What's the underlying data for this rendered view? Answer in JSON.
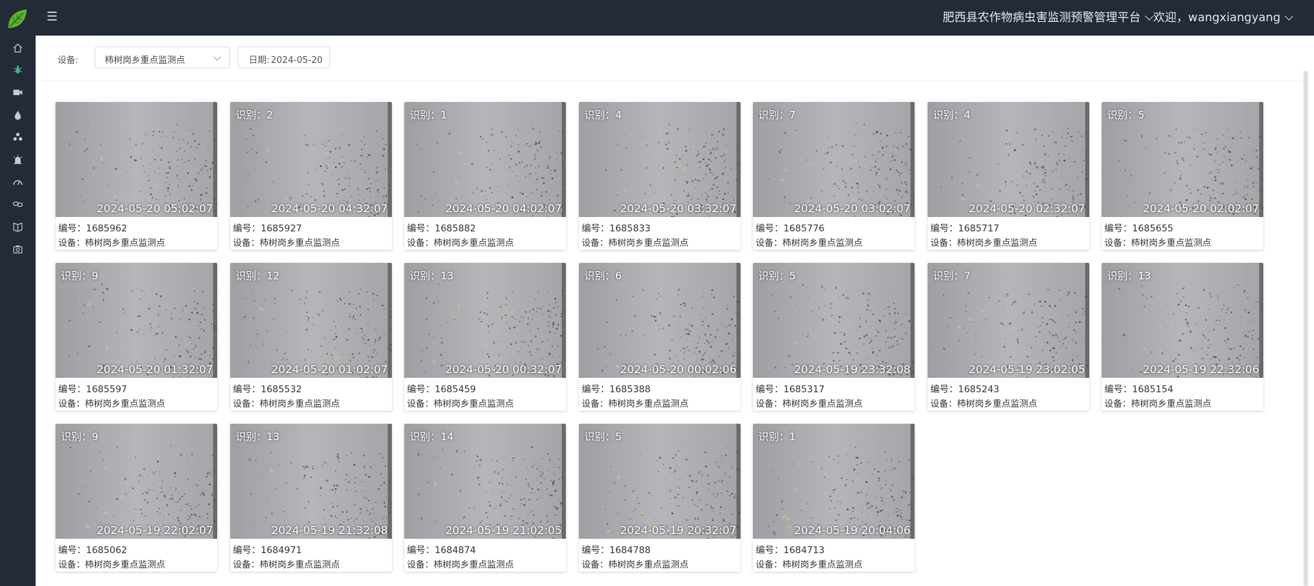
{
  "header": {
    "platform_title": "肥西县农作物病虫害监测预警管理平台",
    "welcome_text": "欢迎，wangxiangyang",
    "brand_color": "#232a38",
    "logo_color": "#5cb531"
  },
  "sidebar": {
    "items": [
      {
        "icon": "home-icon",
        "active": false
      },
      {
        "icon": "bug-icon",
        "active": true
      },
      {
        "icon": "video-camera-icon",
        "active": false
      },
      {
        "icon": "water-drop-icon",
        "active": false
      },
      {
        "icon": "molecule-icon",
        "active": false
      },
      {
        "icon": "alarm-lamp-icon",
        "active": false
      },
      {
        "icon": "gauge-icon",
        "active": false
      },
      {
        "icon": "link-icon",
        "active": false
      },
      {
        "icon": "book-icon",
        "active": false
      },
      {
        "icon": "camera-icon",
        "active": false
      }
    ],
    "active_color": "#3dbb7a"
  },
  "filters": {
    "device_label": "设备:",
    "device_value": "柿树岗乡重点监测点",
    "date_label": "日期:",
    "date_value": "2024-05-20"
  },
  "cards": [
    {
      "count": "",
      "time": "2024-05-20 05:02:07",
      "id_text": "编号：1685962",
      "device_text": "设备：柿树岗乡重点监测点"
    },
    {
      "count": "识别：2",
      "time": "2024-05-20 04:32:07",
      "id_text": "编号：1685927",
      "device_text": "设备：柿树岗乡重点监测点"
    },
    {
      "count": "识别：1",
      "time": "2024-05-20 04:02:07",
      "id_text": "编号：1685882",
      "device_text": "设备：柿树岗乡重点监测点"
    },
    {
      "count": "识别：4",
      "time": "2024-05-20 03:32:07",
      "id_text": "编号：1685833",
      "device_text": "设备：柿树岗乡重点监测点"
    },
    {
      "count": "识别：7",
      "time": "2024-05-20 03:02:07",
      "id_text": "编号：1685776",
      "device_text": "设备：柿树岗乡重点监测点"
    },
    {
      "count": "识别：4",
      "time": "2024-05-20 02:32:07",
      "id_text": "编号：1685717",
      "device_text": "设备：柿树岗乡重点监测点"
    },
    {
      "count": "识别：5",
      "time": "2024-05-20 02:02:07",
      "id_text": "编号：1685655",
      "device_text": "设备：柿树岗乡重点监测点"
    },
    {
      "count": "识别：9",
      "time": "2024-05-20 01:32:07",
      "id_text": "编号：1685597",
      "device_text": "设备：柿树岗乡重点监测点"
    },
    {
      "count": "识别：12",
      "time": "2024-05-20 01:02:07",
      "id_text": "编号：1685532",
      "device_text": "设备：柿树岗乡重点监测点"
    },
    {
      "count": "识别：13",
      "time": "2024-05-20 00:32:07",
      "id_text": "编号：1685459",
      "device_text": "设备：柿树岗乡重点监测点"
    },
    {
      "count": "识别：6",
      "time": "2024-05-20 00:02:06",
      "id_text": "编号：1685388",
      "device_text": "设备：柿树岗乡重点监测点"
    },
    {
      "count": "识别：5",
      "time": "2024-05-19 23:32:08",
      "id_text": "编号：1685317",
      "device_text": "设备：柿树岗乡重点监测点"
    },
    {
      "count": "识别：7",
      "time": "2024-05-19 23:02:05",
      "id_text": "编号：1685243",
      "device_text": "设备：柿树岗乡重点监测点"
    },
    {
      "count": "识别：13",
      "time": "2024-05-19 22:32:06",
      "id_text": "编号：1685154",
      "device_text": "设备：柿树岗乡重点监测点"
    },
    {
      "count": "识别：9",
      "time": "2024-05-19 22:02:07",
      "id_text": "编号：1685062",
      "device_text": "设备：柿树岗乡重点监测点"
    },
    {
      "count": "识别：13",
      "time": "2024-05-19 21:32:08",
      "id_text": "编号：1684971",
      "device_text": "设备：柿树岗乡重点监测点"
    },
    {
      "count": "识别：14",
      "time": "2024-05-19 21:02:05",
      "id_text": "编号：1684874",
      "device_text": "设备：柿树岗乡重点监测点"
    },
    {
      "count": "识别：5",
      "time": "2024-05-19 20:32:07",
      "id_text": "编号：1684788",
      "device_text": "设备：柿树岗乡重点监测点"
    },
    {
      "count": "识别：1",
      "time": "2024-05-19 20:04:06",
      "id_text": "编号：1684713",
      "device_text": "设备：柿树岗乡重点监测点"
    }
  ]
}
